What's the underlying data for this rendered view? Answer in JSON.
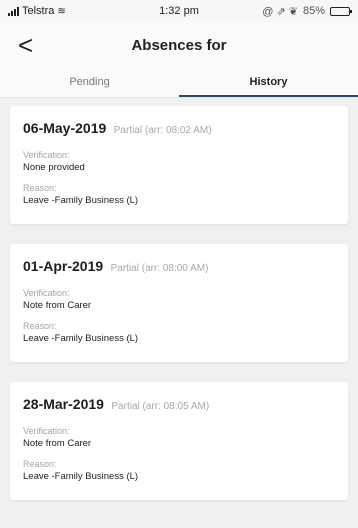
{
  "status_bar": {
    "carrier": "Telstra",
    "time": "1:32 pm",
    "right_icons": "@ ⇗ ❦",
    "battery": "85%",
    "battery_level": 0.85
  },
  "header": {
    "back_glyph": "<",
    "title": "Absences for"
  },
  "tabs": [
    {
      "label": "Pending",
      "active": false
    },
    {
      "label": "History",
      "active": true
    }
  ],
  "absences": [
    {
      "date": "06-May-2019",
      "partial": "Partial (arr: 08:02 AM)",
      "verification_label": "Verification:",
      "verification": "None provided",
      "reason_label": "Reason:",
      "reason": "Leave -Family Business (L)"
    },
    {
      "date": "01-Apr-2019",
      "partial": "Partial (arr: 08:00 AM)",
      "verification_label": "Verification:",
      "verification": "Note from Carer",
      "reason_label": "Reason:",
      "reason": "Leave -Family Business (L)"
    },
    {
      "date": "28-Mar-2019",
      "partial": "Partial (arr: 08:05 AM)",
      "verification_label": "Verification:",
      "verification": "Note from Carer",
      "reason_label": "Reason:",
      "reason": "Leave -Family Business (L)"
    }
  ],
  "colors": {
    "tab_indicator": "#2f4a72",
    "background": "#f0f0f1",
    "card": "#ffffff"
  }
}
